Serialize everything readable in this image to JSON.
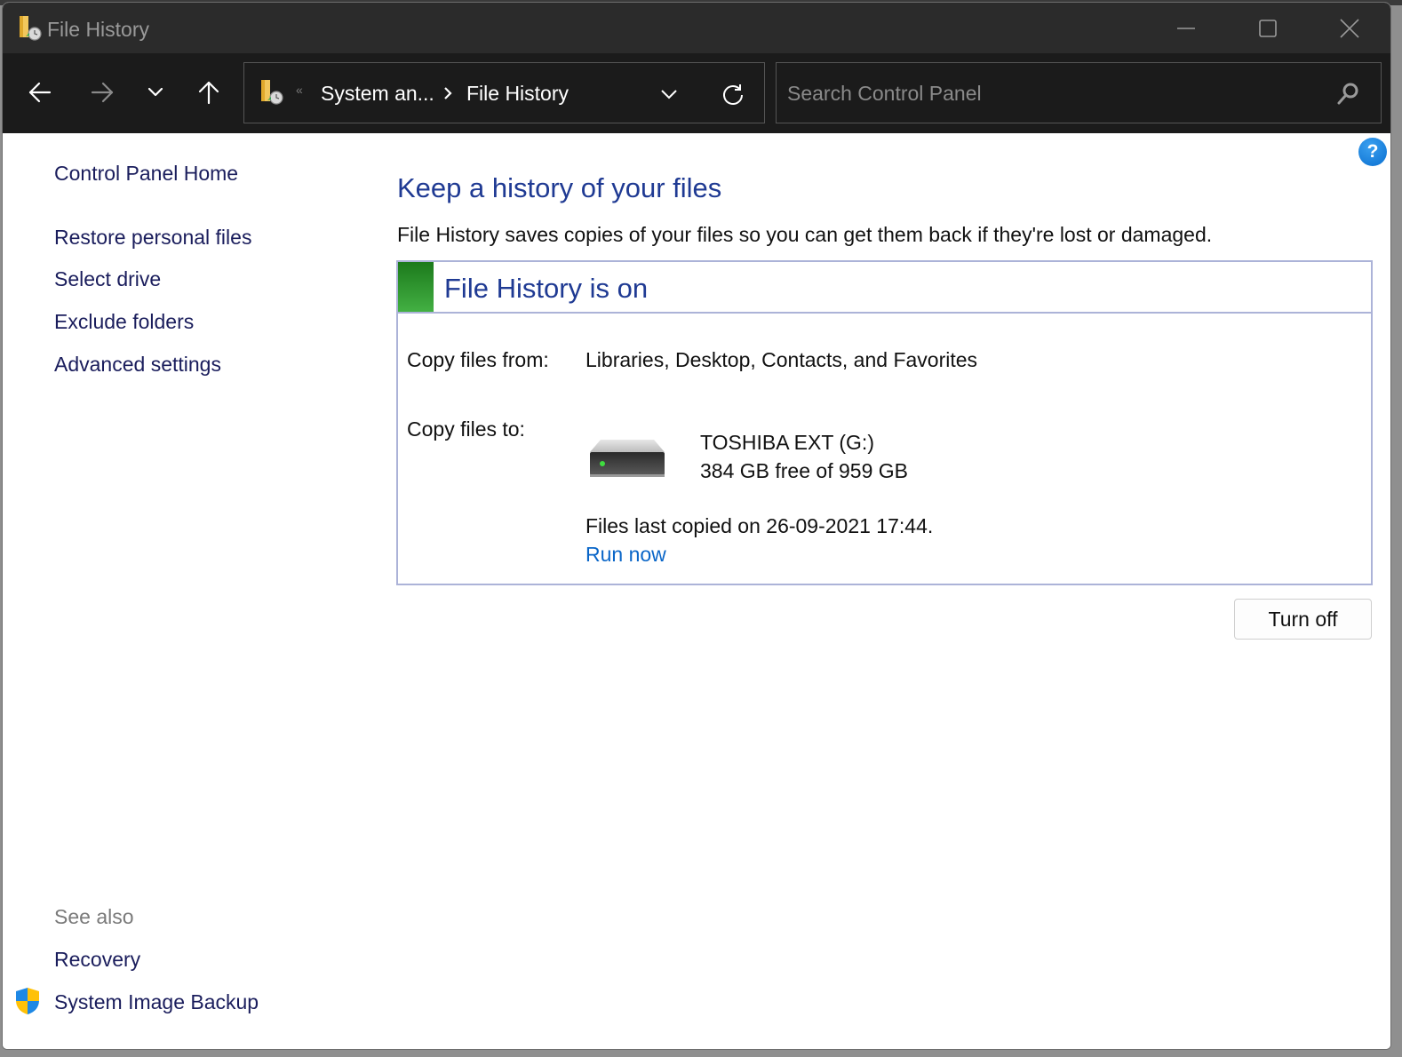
{
  "window": {
    "title": "File History",
    "controls": {
      "minimize": "minimize",
      "maximize": "maximize",
      "close": "close"
    }
  },
  "navbar": {
    "back": "back-arrow",
    "forward": "forward-arrow",
    "recent": "recent-locations-chevron",
    "up": "up-arrow",
    "address": {
      "overflow": "«",
      "breadcrumbs": [
        "System an...",
        "File History"
      ]
    },
    "search": {
      "placeholder": "Search Control Panel",
      "value": ""
    }
  },
  "sidebar": {
    "home": "Control Panel Home",
    "tasks": [
      "Restore personal files",
      "Select drive",
      "Exclude folders",
      "Advanced settings"
    ],
    "see_also_heading": "See also",
    "see_also": [
      "Recovery",
      "System Image Backup"
    ]
  },
  "main": {
    "help": "?",
    "title": "Keep a history of your files",
    "description": "File History saves copies of your files so you can get them back if they're lost or damaged.",
    "status": {
      "title": "File History is on",
      "status_color": "#2e9a2e",
      "copy_from_label": "Copy files from:",
      "copy_from_value": "Libraries, Desktop, Contacts, and Favorites",
      "copy_to_label": "Copy files to:",
      "drive_name": "TOSHIBA EXT (G:)",
      "drive_space": "384 GB free of 959 GB",
      "last_copied": "Files last copied on 26-09-2021 17:44.",
      "run_now": "Run now"
    },
    "turn_off": "Turn off"
  },
  "colors": {
    "heading": "#1f3a93",
    "link": "#1a1d5c",
    "action_link": "#0a66c8",
    "titlebar": "#2b2b2b",
    "navbar": "#1b1b1b"
  }
}
